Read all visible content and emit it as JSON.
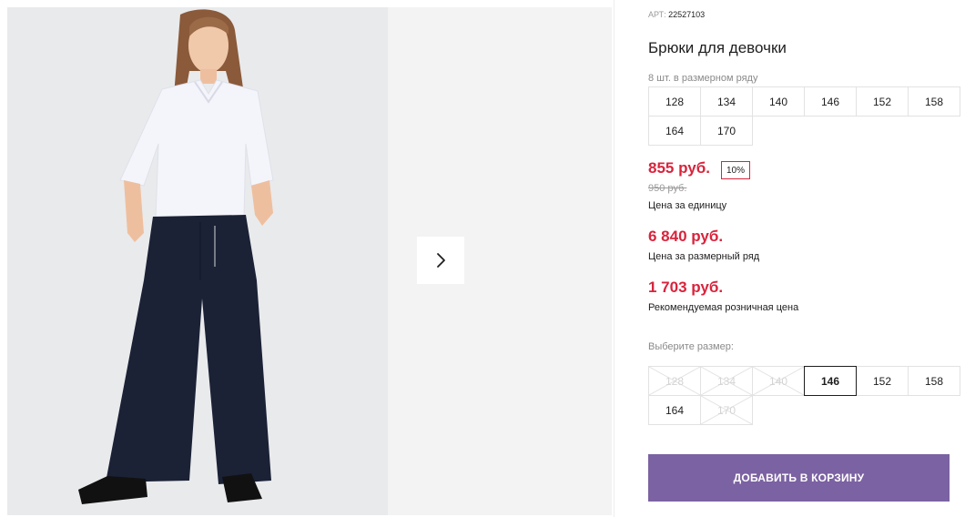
{
  "product": {
    "sku_label": "АРТ:",
    "sku": "22527103",
    "title": "Брюки для девочки"
  },
  "size_range": {
    "caption": "8 шт. в размерном ряду",
    "sizes": [
      "128",
      "134",
      "140",
      "146",
      "152",
      "158",
      "164",
      "170"
    ]
  },
  "pricing": {
    "unit_price": "855 руб.",
    "discount": "10%",
    "old_price": "950 руб.",
    "unit_caption": "Цена за единицу",
    "range_price": "6 840 руб.",
    "range_caption": "Цена за размерный ряд",
    "retail_price": "1 703 руб.",
    "retail_caption": "Рекомендуемая розничная цена"
  },
  "size_picker": {
    "caption": "Выберите размер:",
    "sizes": [
      {
        "label": "128",
        "state": "disabled"
      },
      {
        "label": "134",
        "state": "disabled"
      },
      {
        "label": "140",
        "state": "disabled"
      },
      {
        "label": "146",
        "state": "selected"
      },
      {
        "label": "152",
        "state": "available"
      },
      {
        "label": "158",
        "state": "available"
      },
      {
        "label": "164",
        "state": "available"
      },
      {
        "label": "170",
        "state": "disabled"
      }
    ]
  },
  "cart_button": "ДОБАВИТЬ В КОРЗИНУ",
  "icons": {
    "next": "chevron-right-icon",
    "unavailable": "cross-out-icon"
  },
  "colors": {
    "price": "#d8243c",
    "accent": "#7b62a2",
    "border": "#e2e2e2"
  }
}
